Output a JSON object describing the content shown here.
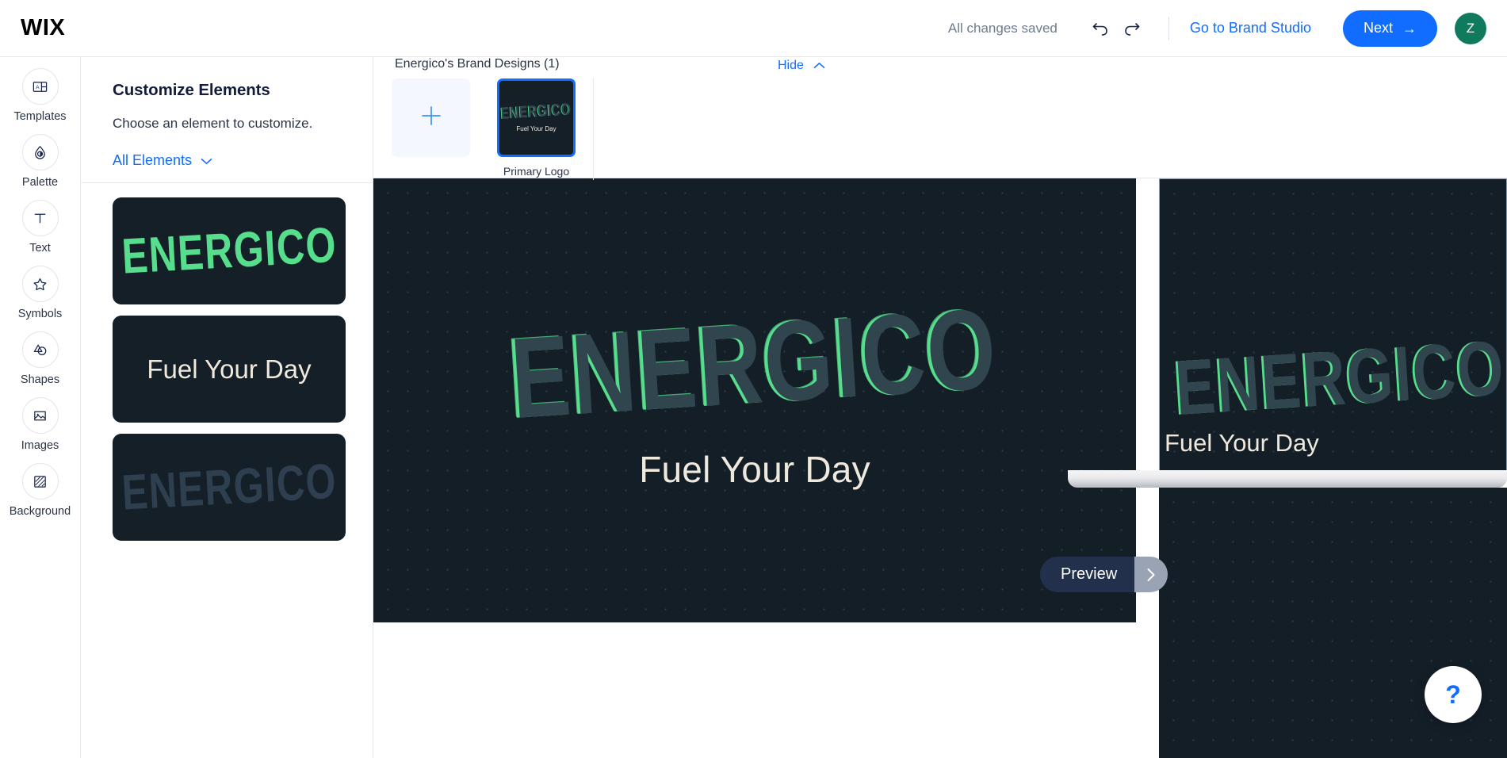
{
  "header": {
    "logo_text": "WIX",
    "save_status": "All changes saved",
    "undo_icon": "undo-icon",
    "redo_icon": "redo-icon",
    "brand_studio_link": "Go to Brand Studio",
    "next_label": "Next",
    "next_arrow": "→",
    "avatar_initial": "Z",
    "accent_color": "#116dff",
    "avatar_color": "#0f7a5e"
  },
  "sidebar": {
    "items": [
      {
        "label": "Templates",
        "icon": "templates-icon"
      },
      {
        "label": "Palette",
        "icon": "palette-droplet-icon"
      },
      {
        "label": "Text",
        "icon": "text-t-icon"
      },
      {
        "label": "Symbols",
        "icon": "star-icon"
      },
      {
        "label": "Shapes",
        "icon": "shapes-icon"
      },
      {
        "label": "Images",
        "icon": "image-icon"
      },
      {
        "label": "Background",
        "icon": "background-icon"
      }
    ]
  },
  "panel": {
    "title": "Customize Elements",
    "subtitle": "Choose an element to customize.",
    "filter_value": "All Elements",
    "filter_chevron": "chevron-down-icon",
    "elements": [
      {
        "name": "wordmark-green",
        "text": "ENERGICO",
        "style": "green",
        "kind": "wordmark"
      },
      {
        "name": "tagline",
        "text": "Fuel Your Day",
        "style": "light",
        "kind": "tagline"
      },
      {
        "name": "wordmark-shadow",
        "text": "ENERGICO",
        "style": "dark",
        "kind": "wordmark"
      }
    ]
  },
  "designs": {
    "title": "Energico's Brand Designs (1)",
    "hide_label": "Hide",
    "hide_chevron": "chevron-up-icon",
    "add_icon": "plus-icon",
    "items": [
      {
        "caption": "Primary Logo",
        "wordmark": "ENERGICO",
        "tagline": "Fuel Your Day",
        "selected": true
      }
    ]
  },
  "canvas": {
    "logo": {
      "wordmark": "ENERGICO",
      "tagline": "Fuel Your Day",
      "wordmark_color": "#31454f",
      "wordmark_accent": "#56de8d",
      "tagline_color": "#efe9dd",
      "background_color": "#141e27"
    },
    "preview": {
      "label": "Preview",
      "arrow_icon": "chevron-right-icon"
    },
    "help": {
      "label": "?",
      "icon": "help-question-icon"
    }
  }
}
